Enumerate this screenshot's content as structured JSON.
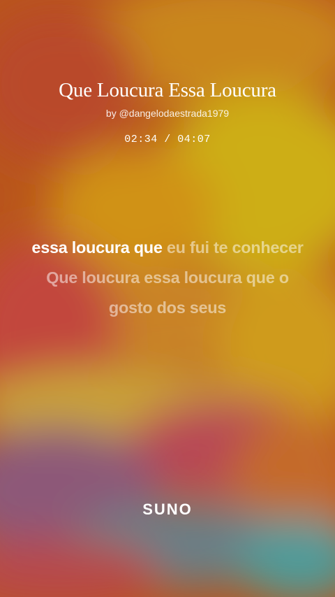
{
  "song": {
    "title": "Que Loucura Essa Loucura",
    "artist": "by @dangelodaestrada1979",
    "time": "02:34 / 04:07"
  },
  "lyrics": {
    "sung": "essa loucura que",
    "upcoming": "eu fui te conhecer Que loucura essa loucura que o gosto dos seus"
  },
  "brand": {
    "logo": "SUNO"
  },
  "colors": {
    "background_base": "#b9551c",
    "swirl_colors": [
      "#c47a10",
      "#cfae15",
      "#c43c3c",
      "#7b5a9a",
      "#4e9c9a"
    ]
  }
}
